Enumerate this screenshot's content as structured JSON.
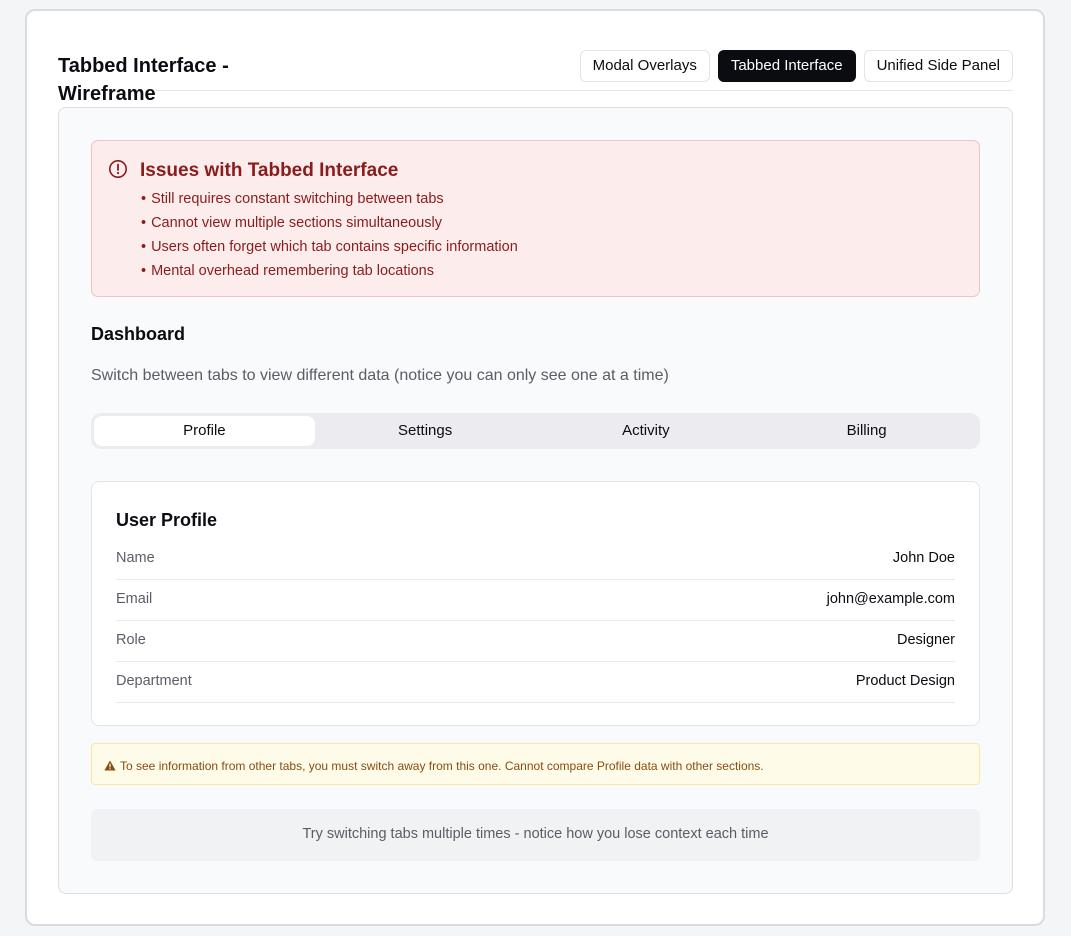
{
  "page": {
    "title": "Tabbed Interface - Wireframe"
  },
  "top_nav": {
    "items": [
      {
        "label": "Modal Overlays",
        "active": false
      },
      {
        "label": "Tabbed Interface",
        "active": true
      },
      {
        "label": "Unified Side Panel",
        "active": false
      }
    ]
  },
  "issues": {
    "icon": "alert-circle-icon",
    "title": "Issues with Tabbed Interface",
    "items": [
      "Still requires constant switching between tabs",
      "Cannot view multiple sections simultaneously",
      "Users often forget which tab contains specific information",
      "Mental overhead remembering tab locations"
    ],
    "color": "#8a1c1c"
  },
  "dashboard": {
    "title": "Dashboard",
    "description": "Switch between tabs to view different data (notice you can only see one at a time)",
    "tabs": [
      {
        "label": "Profile",
        "active": true
      },
      {
        "label": "Settings",
        "active": false
      },
      {
        "label": "Activity",
        "active": false
      },
      {
        "label": "Billing",
        "active": false
      }
    ]
  },
  "profile": {
    "title": "User Profile",
    "rows": [
      {
        "label": "Name",
        "value": "John Doe"
      },
      {
        "label": "Email",
        "value": "john@example.com"
      },
      {
        "label": "Role",
        "value": "Designer"
      },
      {
        "label": "Department",
        "value": "Product Design"
      }
    ]
  },
  "warning": {
    "icon": "warning-triangle-icon",
    "text": "To see information from other tabs, you must switch away from this one. Cannot compare Profile data with other sections."
  },
  "hint": {
    "text": "Try switching tabs multiple times - notice how you lose context each time"
  }
}
